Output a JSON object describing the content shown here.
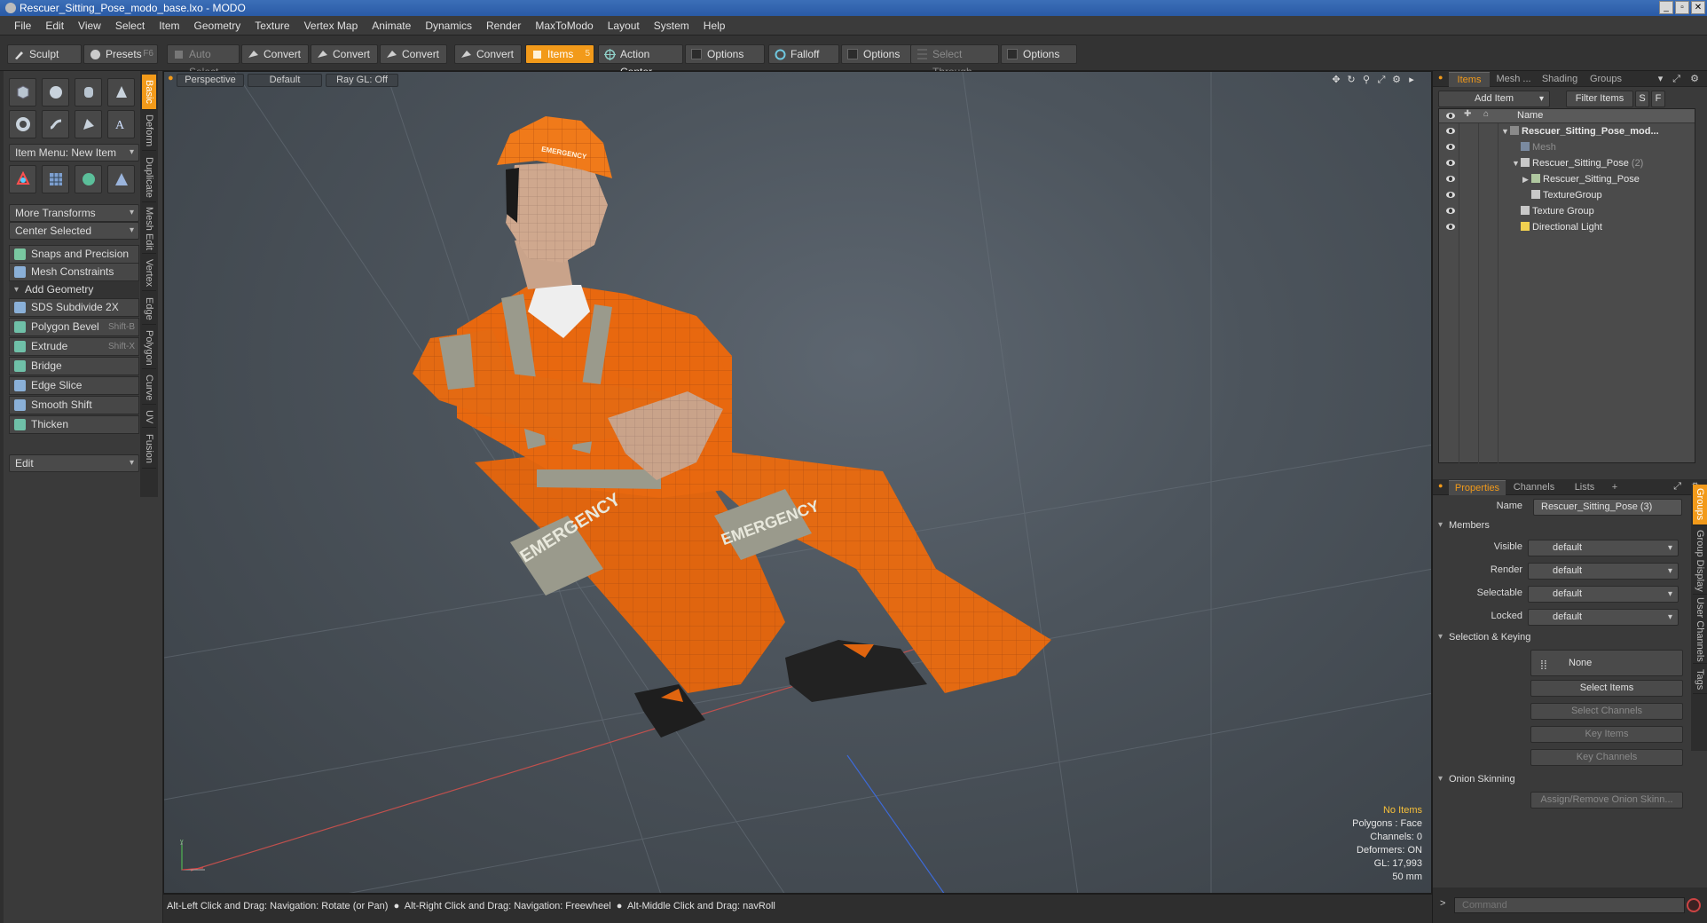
{
  "window": {
    "title": "Rescuer_Sitting_Pose_modo_base.lxo - MODO",
    "controls": [
      "_",
      "▫",
      "✕"
    ]
  },
  "menu": [
    "File",
    "Edit",
    "View",
    "Select",
    "Item",
    "Geometry",
    "Texture",
    "Vertex Map",
    "Animate",
    "Dynamics",
    "Render",
    "MaxToModo",
    "Layout",
    "System",
    "Help"
  ],
  "toolbar": {
    "sculpt": "Sculpt",
    "presets": "Presets",
    "presets_hotkey": "F6",
    "auto_select": "Auto Select",
    "convert1": "Convert",
    "convert2": "Convert",
    "convert3": "Convert",
    "convert4": "Convert",
    "items": "Items",
    "items_hotkey": "5",
    "action_center": "Action Center",
    "options1": "Options",
    "falloff": "Falloff",
    "options2": "Options",
    "select_through": "Select Through",
    "options3": "Options"
  },
  "left": {
    "item_menu": "Item Menu: New Item",
    "more_transforms": "More Transforms",
    "center_selected": "Center Selected",
    "snaps": "Snaps and Precision",
    "mesh_constraints": "Mesh Constraints",
    "add_geometry": "Add Geometry",
    "tools": [
      {
        "label": "SDS Subdivide 2X",
        "hotkey": ""
      },
      {
        "label": "Polygon Bevel",
        "hotkey": "Shift-B"
      },
      {
        "label": "Extrude",
        "hotkey": "Shift-X"
      },
      {
        "label": "Bridge",
        "hotkey": ""
      },
      {
        "label": "Edge Slice",
        "hotkey": ""
      },
      {
        "label": "Smooth Shift",
        "hotkey": ""
      },
      {
        "label": "Thicken",
        "hotkey": ""
      }
    ],
    "edit": "Edit",
    "vtabs": [
      "Basic",
      "Deform",
      "Duplicate",
      "Mesh Edit",
      "Vertex",
      "Edge",
      "Polygon",
      "Curve",
      "UV",
      "Fusion"
    ]
  },
  "viewport": {
    "perspective": "Perspective",
    "default": "Default",
    "raygl": "Ray GL: Off",
    "info": {
      "no_items": "No Items",
      "polygons": "Polygons : Face",
      "channels": "Channels: 0",
      "deformers": "Deformers: ON",
      "gl": "GL: 17,993",
      "mm": "50 mm"
    },
    "helmet_text": "EMERGENCY",
    "sleeve_text": "EMERGENCY",
    "leg_text": "EMERGENCY"
  },
  "status": {
    "s1": "Alt-Left Click and Drag: Navigation: Rotate (or Pan)",
    "s2": "Alt-Right Click and Drag: Navigation: Freewheel",
    "s3": "Alt-Middle Click and Drag: navRoll"
  },
  "items_panel": {
    "tabs": [
      "Items",
      "Mesh ...",
      "Shading",
      "Groups"
    ],
    "add_item": "Add Item",
    "filter_items": "Filter Items",
    "s": "S",
    "f": "F",
    "name_col": "Name",
    "rows": [
      {
        "name": "Rescuer_Sitting_Pose_mod...",
        "suffix": ""
      },
      {
        "name": "Mesh",
        "suffix": ""
      },
      {
        "name": "Rescuer_Sitting_Pose",
        "suffix": "(2)"
      },
      {
        "name": "Rescuer_Sitting_Pose",
        "suffix": ""
      },
      {
        "name": "TextureGroup",
        "suffix": ""
      },
      {
        "name": "Texture Group",
        "suffix": ""
      },
      {
        "name": "Directional Light",
        "suffix": ""
      }
    ]
  },
  "properties": {
    "tabs": [
      "Properties",
      "Channels",
      "Lists",
      "+"
    ],
    "name_label": "Name",
    "name_value": "Rescuer_Sitting_Pose (3)",
    "members": "Members",
    "visible_label": "Visible",
    "visible": "default",
    "render_label": "Render",
    "render": "default",
    "selectable_label": "Selectable",
    "selectable": "default",
    "locked_label": "Locked",
    "locked": "default",
    "selection_keying": "Selection & Keying",
    "none": "None",
    "select_items": "Select Items",
    "select_channels": "Select Channels",
    "key_items": "Key Items",
    "key_channels": "Key Channels",
    "onion": "Onion Skinning",
    "assign_onion": "Assign/Remove Onion Skinn...",
    "vtabs": [
      "Groups",
      "Group Display",
      "User Channels",
      "Tags"
    ]
  },
  "command": {
    "placeholder": "Command"
  },
  "colors": {
    "accent": "#f29a1a",
    "suit": "#e0650f",
    "reflective": "#9a9a8c"
  }
}
